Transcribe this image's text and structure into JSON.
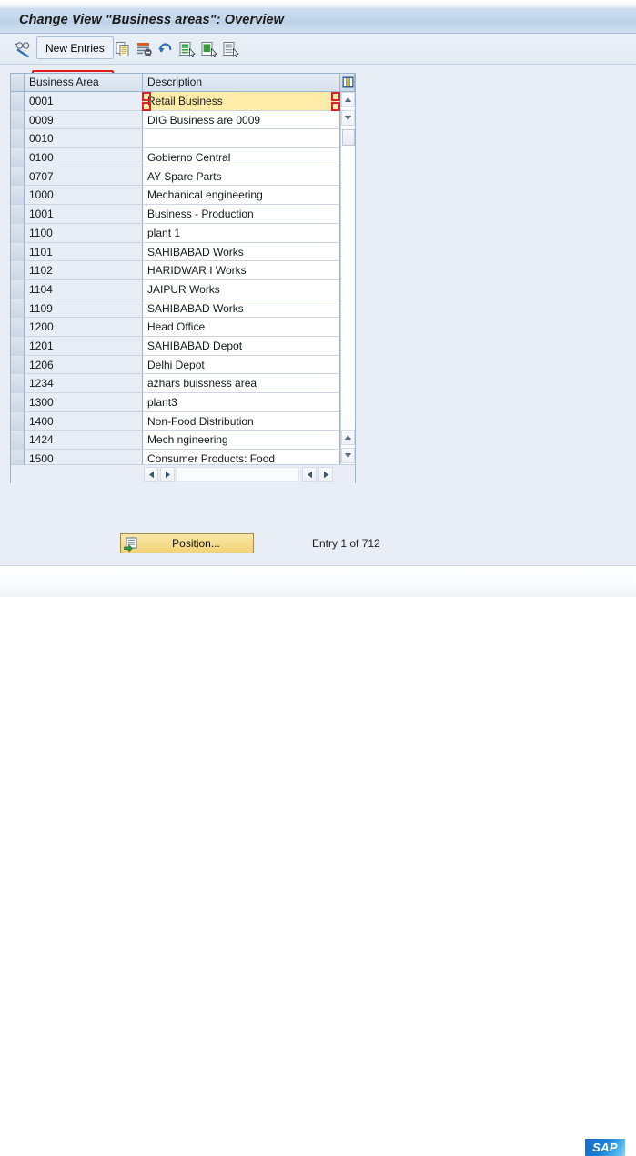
{
  "window": {
    "title": "Change View \"Business areas\": Overview"
  },
  "toolbar": {
    "display_change_icon": "glasses-pencil-icon",
    "new_entries_label": "New Entries",
    "items": [
      {
        "icon": "copy-icon",
        "name": "copy-as-button"
      },
      {
        "icon": "delete-icon",
        "name": "delete-button"
      },
      {
        "icon": "undo-icon",
        "name": "undo-button"
      },
      {
        "icon": "select-all-icon",
        "name": "select-all-button"
      },
      {
        "icon": "select-block-icon",
        "name": "select-block-button"
      },
      {
        "icon": "deselect-all-icon",
        "name": "deselect-all-button"
      }
    ]
  },
  "table": {
    "columns": [
      "Business Area",
      "Description"
    ],
    "config_icon": "column-config-icon",
    "selected_row_index": 0,
    "rows": [
      {
        "key": "0001",
        "description": "Retail Business"
      },
      {
        "key": "0009",
        "description": "DIG Business are 0009"
      },
      {
        "key": "0010",
        "description": ""
      },
      {
        "key": "0100",
        "description": "Gobierno Central"
      },
      {
        "key": "0707",
        "description": "AY Spare Parts"
      },
      {
        "key": "1000",
        "description": "Mechanical engineering"
      },
      {
        "key": "1001",
        "description": "Business - Production"
      },
      {
        "key": "1100",
        "description": "plant 1"
      },
      {
        "key": "1101",
        "description": "SAHIBABAD Works"
      },
      {
        "key": "1102",
        "description": "HARIDWAR I Works"
      },
      {
        "key": "1104",
        "description": "JAIPUR Works"
      },
      {
        "key": "1109",
        "description": "SAHIBABAD Works"
      },
      {
        "key": "1200",
        "description": "Head Office"
      },
      {
        "key": "1201",
        "description": "SAHIBABAD Depot"
      },
      {
        "key": "1206",
        "description": "Delhi Depot"
      },
      {
        "key": "1234",
        "description": "azhars buissness area"
      },
      {
        "key": "1300",
        "description": "plant3"
      },
      {
        "key": "1400",
        "description": "Non-Food Distribution"
      },
      {
        "key": "1424",
        "description": "Mech ngineering"
      },
      {
        "key": "1500",
        "description": "Consumer Products: Food"
      }
    ]
  },
  "footer": {
    "position_label": "Position...",
    "position_icon": "position-arrow-icon",
    "entry_status": "Entry 1 of 712"
  },
  "statusbar": {
    "logo_text": "SAP"
  },
  "colors": {
    "title_bar": "#c3d6ea",
    "background": "#e9eef6",
    "selection_highlight": "#ffeca8",
    "focus_ring": "#e01b1b",
    "key_column": "#e8eef6",
    "sap_blue": "#1b7fd6"
  }
}
